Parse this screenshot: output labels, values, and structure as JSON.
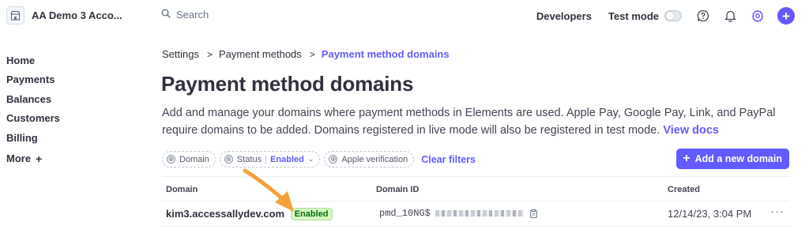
{
  "account": {
    "name": "AA Demo 3 Acco..."
  },
  "sidebar": {
    "items": [
      {
        "label": "Home"
      },
      {
        "label": "Payments"
      },
      {
        "label": "Balances"
      },
      {
        "label": "Customers"
      },
      {
        "label": "Billing"
      },
      {
        "label": "More"
      }
    ],
    "more_icon": "+"
  },
  "topbar": {
    "search_placeholder": "Search",
    "developers": "Developers",
    "test_mode": "Test mode",
    "test_mode_on": false,
    "icons": [
      "help-icon",
      "bell-icon",
      "gear-icon",
      "create-plus-icon"
    ],
    "create_glyph": "+"
  },
  "breadcrumb": {
    "items": [
      "Settings",
      "Payment methods",
      "Payment method domains"
    ],
    "separator": ">"
  },
  "page": {
    "title": "Payment method domains",
    "description": "Add and manage your domains where payment methods in Elements are used. Apple Pay, Google Pay, Link, and PayPal require domains to be added. Domains registered in live mode will also be registered in test mode.",
    "docs_link": "View docs"
  },
  "filters": {
    "domain": "Domain",
    "status_label": "Status",
    "status_value": "Enabled",
    "apple": "Apple verification",
    "clear": "Clear filters",
    "add_icon": "⊕",
    "remove_icon": "⊗",
    "chevron": "⌄"
  },
  "add_button": {
    "plus": "+",
    "label": "Add a new domain"
  },
  "table": {
    "columns": [
      "Domain",
      "Domain ID",
      "Created"
    ],
    "rows": [
      {
        "domain": "kim3.accessallydev.com",
        "status": "Enabled",
        "domain_id": "pmd_10NG$",
        "created": "12/14/23, 3:04 PM",
        "more": "···"
      }
    ]
  },
  "colors": {
    "accent": "#635bff",
    "badge_bg": "#d7f7c2",
    "badge_text": "#05690d",
    "arrow": "#f5a13b"
  }
}
